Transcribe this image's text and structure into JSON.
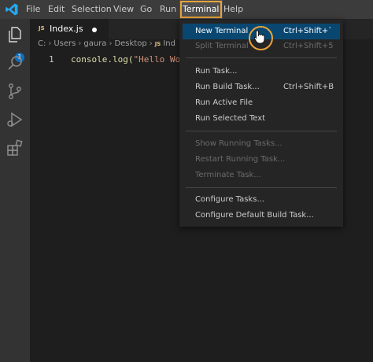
{
  "menubar": {
    "items": [
      "File",
      "Edit",
      "Selection",
      "View",
      "Go",
      "Run",
      "Terminal",
      "Help"
    ],
    "active": "Terminal"
  },
  "activity": {
    "explorer_badge": "1",
    "icons": [
      "files-icon",
      "search-icon",
      "source-control-icon",
      "run-debug-icon",
      "extensions-icon"
    ]
  },
  "tab": {
    "icon_text": "JS",
    "name": "Index.js"
  },
  "breadcrumb": {
    "parts": [
      "C:",
      "Users",
      "gaura",
      "Desktop"
    ],
    "file_icon": "JS",
    "file": "Ind"
  },
  "editor": {
    "line_number": "1",
    "code_fn": "console.log(",
    "code_str": "\"Hello Worl"
  },
  "terminal_menu": {
    "new_terminal": {
      "label": "New Terminal",
      "shortcut": "Ctrl+Shift+`"
    },
    "split_terminal": {
      "label": "Split Terminal",
      "shortcut": "Ctrl+Shift+5"
    },
    "run_task": {
      "label": "Run Task..."
    },
    "run_build_task": {
      "label": "Run Build Task...",
      "shortcut": "Ctrl+Shift+B"
    },
    "run_active_file": {
      "label": "Run Active File"
    },
    "run_selected_text": {
      "label": "Run Selected Text"
    },
    "show_running_tasks": {
      "label": "Show Running Tasks..."
    },
    "restart_running_task": {
      "label": "Restart Running Task..."
    },
    "terminate_task": {
      "label": "Terminate Task..."
    },
    "configure_tasks": {
      "label": "Configure Tasks..."
    },
    "configure_default_build_task": {
      "label": "Configure Default Build Task..."
    }
  },
  "colors": {
    "highlight": "#e8a33a",
    "selected_bg": "#094771",
    "vscode_blue": "#0e70c0"
  }
}
